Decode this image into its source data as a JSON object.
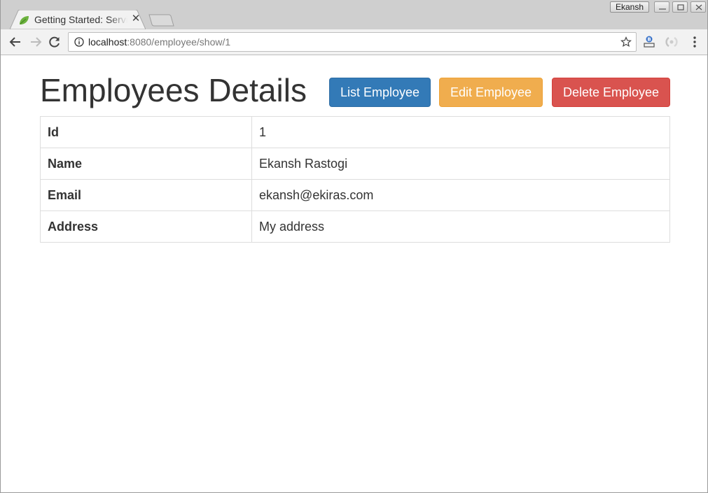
{
  "browser": {
    "tab": {
      "title": "Getting Started: Serving Web Content",
      "favicon": "spring-leaf-icon"
    },
    "user": "Ekansh",
    "address_bar": {
      "host": "localhost",
      "path": ":8080/employee/show/1"
    }
  },
  "page": {
    "title": "Employees Details",
    "buttons": {
      "list": "List Employee",
      "edit": "Edit Employee",
      "delete": "Delete Employee"
    },
    "details": [
      {
        "label": "Id",
        "value": "1"
      },
      {
        "label": "Name",
        "value": "Ekansh Rastogi"
      },
      {
        "label": "Email",
        "value": "ekansh@ekiras.com"
      },
      {
        "label": "Address",
        "value": "My address"
      }
    ]
  },
  "colors": {
    "primary": "#337ab7",
    "warning": "#f0ad4e",
    "danger": "#d9534f"
  }
}
